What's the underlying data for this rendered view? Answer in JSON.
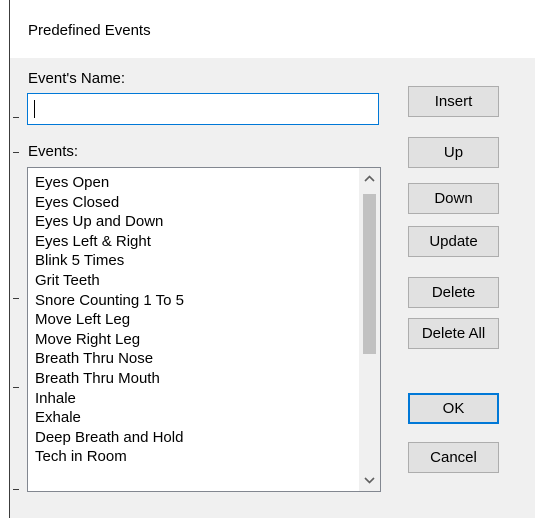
{
  "dialog": {
    "title": "Predefined Events"
  },
  "form": {
    "name_label": "Event's Name:",
    "name_value": "",
    "events_label": "Events:"
  },
  "events": {
    "items": [
      "Eyes Open",
      "Eyes Closed",
      "Eyes Up and Down",
      "Eyes Left & Right",
      "Blink 5 Times",
      "Grit Teeth",
      "Snore Counting 1 To 5",
      "Move Left Leg",
      "Move Right Leg",
      "Breath Thru Nose",
      "Breath Thru Mouth",
      "Inhale",
      "Exhale",
      "Deep Breath and Hold",
      "Tech in Room"
    ]
  },
  "buttons": {
    "insert": "Insert",
    "up": "Up",
    "down": "Down",
    "update": "Update",
    "delete": "Delete",
    "delete_all": "Delete All",
    "ok": "OK",
    "cancel": "Cancel"
  },
  "icons": {
    "scroll_up": "chevron-up-icon",
    "scroll_down": "chevron-down-icon"
  },
  "colors": {
    "focus_accent": "#0078d7",
    "dialog_bg": "#f0f0f0",
    "button_bg": "#e1e1e1",
    "scroll_thumb": "#c1c1c1"
  }
}
